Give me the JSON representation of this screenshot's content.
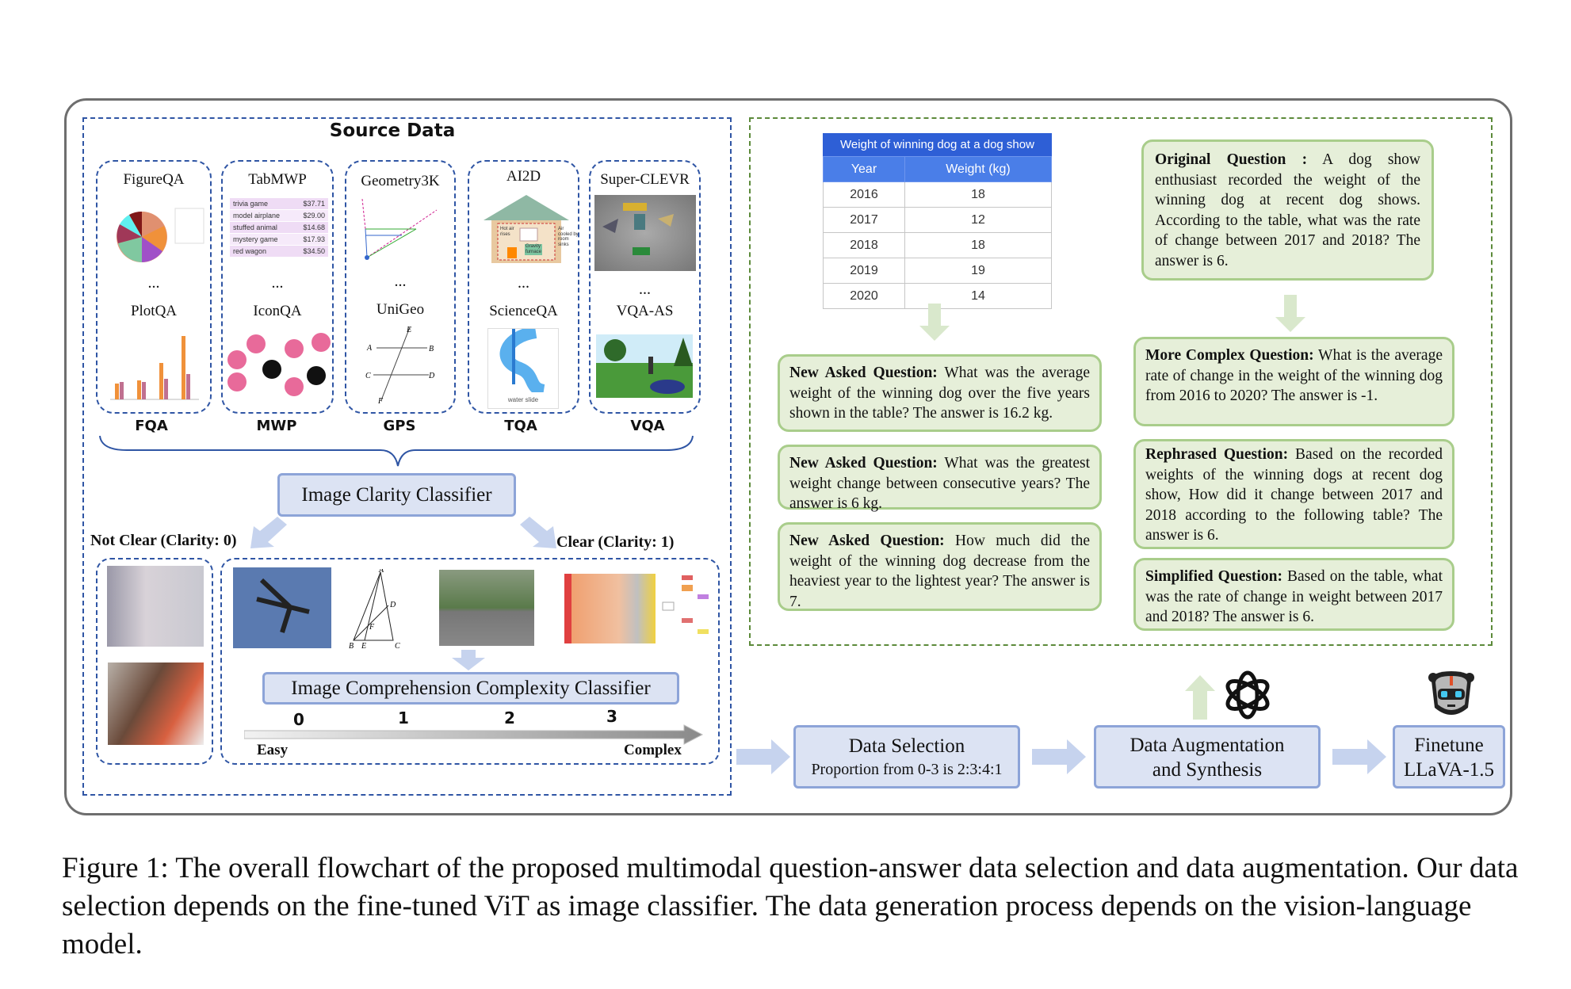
{
  "source_data": {
    "title": "Source Data",
    "datasets": [
      {
        "top": "FigureQA",
        "bottom": "PlotQA",
        "category": "FQA"
      },
      {
        "top": "TabMWP",
        "bottom": "IconQA",
        "category": "MWP"
      },
      {
        "top": "Geometry3K",
        "bottom": "UniGeo",
        "category": "GPS"
      },
      {
        "top": "AI2D",
        "bottom": "ScienceQA",
        "category": "TQA"
      },
      {
        "top": "Super-CLEVR",
        "bottom": "VQA-AS",
        "category": "VQA"
      }
    ],
    "ellipsis": "...",
    "tabmwp_rows": [
      {
        "item": "trivia game",
        "price": "$37.71"
      },
      {
        "item": "model airplane",
        "price": "$29.00"
      },
      {
        "item": "stuffed animal",
        "price": "$14.68"
      },
      {
        "item": "mystery game",
        "price": "$17.93"
      },
      {
        "item": "red wagon",
        "price": "$34.50"
      }
    ],
    "scienceqa_caption": "water slide",
    "ai2d_labels": {
      "hot": "Hot air rises",
      "cool": "Air cooled by room sinks",
      "furnace": "Gravity furnace"
    }
  },
  "clarity": {
    "classifier": "Image Clarity Classifier",
    "not_clear": "Not Clear (Clarity: 0)",
    "clear": "Clear (Clarity: 1)"
  },
  "complexity": {
    "classifier": "Image Comprehension Complexity Classifier",
    "levels": [
      "0",
      "1",
      "2",
      "3"
    ],
    "easy": "Easy",
    "complex": "Complex"
  },
  "table": {
    "title": "Weight of winning dog at a dog show",
    "headers": [
      "Year",
      "Weight (kg)"
    ],
    "rows": [
      [
        "2016",
        "18"
      ],
      [
        "2017",
        "12"
      ],
      [
        "2018",
        "18"
      ],
      [
        "2019",
        "19"
      ],
      [
        "2020",
        "14"
      ]
    ],
    "header_color": "#2e5fd6",
    "subheader_color": "#4a7ee8"
  },
  "questions": {
    "new": [
      {
        "label": "New Asked Question:",
        "text": " What was the average weight of the winning dog over the five years shown in the table? The answer is 16.2 kg."
      },
      {
        "label": "New Asked Question:",
        "text": " What was the greatest weight change between consecutive years? The answer is 6 kg."
      },
      {
        "label": "New Asked Question:",
        "text": " How much did the weight of the winning dog decrease from the heaviest year to the lightest year? The answer is 7."
      }
    ],
    "original": {
      "label": "Original Question :",
      "text": " A dog show enthusiast recorded the weight of the winning dog at recent dog shows. According to the table, what was the rate of change between 2017 and 2018? The answer is 6."
    },
    "variants": [
      {
        "label": "More Complex Question:",
        "text": " What is the average rate of change in the weight of the winning dog from 2016 to 2020? The answer is -1."
      },
      {
        "label": "Rephrased Question:",
        "text": " Based on the recorded weights of the winning dogs at recent dog show, How did it change between 2017 and 2018 according to the following table? The answer is 6."
      },
      {
        "label": "Simplified Question:",
        "text": " Based on the table, what was the rate of change in weight between 2017 and 2018? The answer is 6."
      }
    ]
  },
  "pipeline": {
    "selection_title": "Data Selection",
    "selection_sub": "Proportion from 0-3 is 2:3:4:1",
    "augmentation_line1": "Data Augmentation",
    "augmentation_line2": "and Synthesis",
    "finetune_line1": "Finetune",
    "finetune_line2": "LLaVA-1.5",
    "icons": [
      "openai-logo-icon",
      "robot-icon"
    ]
  },
  "caption": "Figure 1: The overall flowchart of the proposed multimodal question-answer data selection and data augmentation. Our data selection depends on the fine-tuned ViT as image classifier. The data generation process depends on the vision-language model.",
  "colors": {
    "blue_border": "#2f55a4",
    "green_border": "#5c8a3a",
    "green_fill": "#e6efd9",
    "blue_fill": "#dce3f3"
  }
}
